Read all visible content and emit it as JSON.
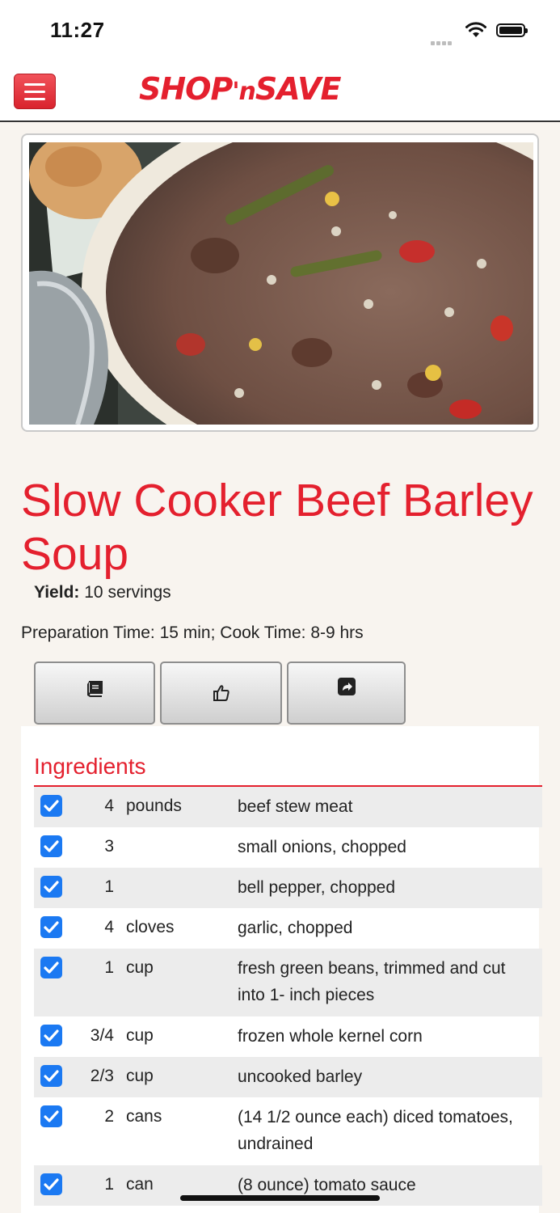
{
  "status_bar": {
    "time": "11:27"
  },
  "header": {
    "logo_text": "SHOP 'n SAVE",
    "logo_main1": "SHOP",
    "logo_n": "'n",
    "logo_main2": "SAVE"
  },
  "recipe": {
    "title": "Slow Cooker Beef Barley Soup",
    "yield_label": "Yield:",
    "yield_value": "10 servings",
    "prep_text": "Preparation Time: 15 min; Cook Time: 8-9 hrs"
  },
  "actions": [
    {
      "name": "recipe-book-button",
      "icon": "book-icon"
    },
    {
      "name": "like-button",
      "icon": "thumbs-up-icon"
    },
    {
      "name": "share-button",
      "icon": "share-icon"
    }
  ],
  "ingredients": {
    "heading": "Ingredients",
    "items": [
      {
        "checked": true,
        "qty": "4",
        "unit": "pounds",
        "desc": "beef stew meat"
      },
      {
        "checked": true,
        "qty": "3",
        "unit": "",
        "desc": "small onions, chopped"
      },
      {
        "checked": true,
        "qty": "1",
        "unit": "",
        "desc": "bell pepper, chopped"
      },
      {
        "checked": true,
        "qty": "4",
        "unit": "cloves",
        "desc": "garlic, chopped"
      },
      {
        "checked": true,
        "qty": "1",
        "unit": "cup",
        "desc": "fresh green beans, trimmed and cut into 1- inch pieces"
      },
      {
        "checked": true,
        "qty": "3/4",
        "unit": "cup",
        "desc": "frozen whole kernel corn"
      },
      {
        "checked": true,
        "qty": "2/3",
        "unit": "cup",
        "desc": "uncooked barley"
      },
      {
        "checked": true,
        "qty": "2",
        "unit": "cans",
        "desc": "(14 1/2 ounce each) diced tomatoes, undrained"
      },
      {
        "checked": true,
        "qty": "1",
        "unit": "can",
        "desc": "(8 ounce) tomato sauce"
      }
    ]
  },
  "colors": {
    "brand_red": "#e4202e",
    "checkbox_blue": "#1b79f2",
    "background": "#f8f4ef"
  }
}
